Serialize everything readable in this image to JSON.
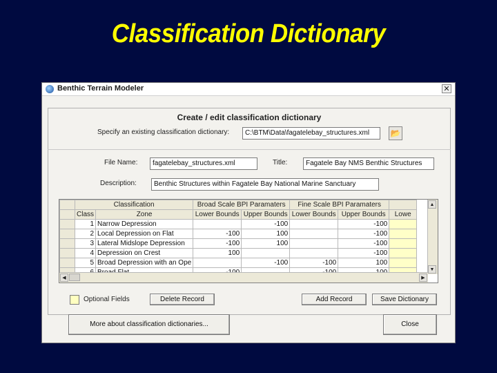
{
  "slide": {
    "title": "Classification Dictionary"
  },
  "window": {
    "title": "Benthic Terrain Modeler",
    "close_glyph": "✕"
  },
  "dialog": {
    "heading": "Create / edit classification dictionary",
    "specify_label": "Specify an existing classification dictionary:",
    "path_value": "C:\\BTM\\Data\\fagatelebay_structures.xml",
    "file_name_label": "File Name:",
    "file_name_value": "fagatelebay_structures.xml",
    "title_label": "Title:",
    "title_value": "Fagatele Bay NMS Benthic Structures",
    "description_label": "Description:",
    "description_value": "Benthic Structures within Fagatele Bay National Marine Sanctuary"
  },
  "grid": {
    "group_headers": [
      "Classification",
      "Broad Scale BPI Paramaters",
      "Fine Scale BPI Paramaters"
    ],
    "columns": [
      "Class",
      "Zone",
      "Lower Bounds",
      "Upper Bounds",
      "Lower Bounds",
      "Upper Bounds",
      "Lowe"
    ],
    "rows": [
      [
        "1",
        "Narrow Depression",
        "",
        "-100",
        "",
        "-100"
      ],
      [
        "2",
        "Local Depression on Flat",
        "-100",
        "100",
        "",
        "-100"
      ],
      [
        "3",
        "Lateral Midslope Depression",
        "-100",
        "100",
        "",
        "-100"
      ],
      [
        "4",
        "Depression on Crest",
        "100",
        "",
        "",
        "-100"
      ],
      [
        "5",
        "Broad Depression with an Ope",
        "",
        "-100",
        "-100",
        "100"
      ],
      [
        "6",
        "Broad Flat",
        "-100",
        "",
        "-100",
        "100"
      ]
    ]
  },
  "buttons": {
    "optional_fields": "Optional Fields",
    "delete_record": "Delete Record",
    "add_record": "Add Record",
    "save_dictionary": "Save Dictionary",
    "more_about": "More about classification dictionaries...",
    "close": "Close"
  },
  "icons": {
    "folder": "folder-open-icon",
    "app": "app-icon"
  },
  "colors": {
    "slide_bg": "#000a40",
    "title": "#ffff00",
    "optional": "#ffffc8"
  }
}
